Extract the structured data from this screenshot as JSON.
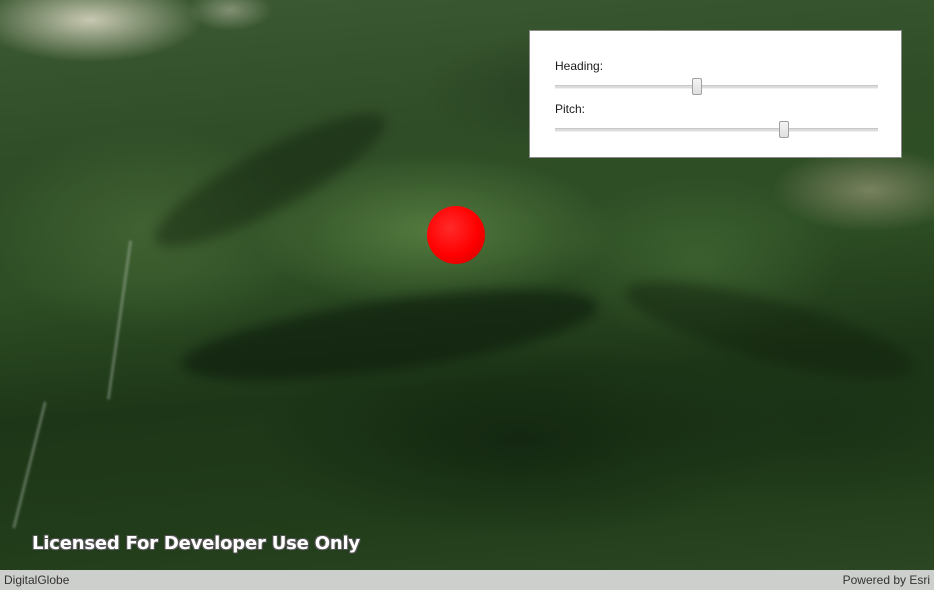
{
  "scene": {
    "watermark": "Licensed For Developer Use Only",
    "marker_color": "#ff0000"
  },
  "attribution": {
    "left": "DigitalGlobe",
    "right": "Powered by Esri"
  },
  "controls": {
    "heading_label": "Heading:",
    "heading_value": 0.44,
    "pitch_label": "Pitch:",
    "pitch_value": 0.71
  }
}
